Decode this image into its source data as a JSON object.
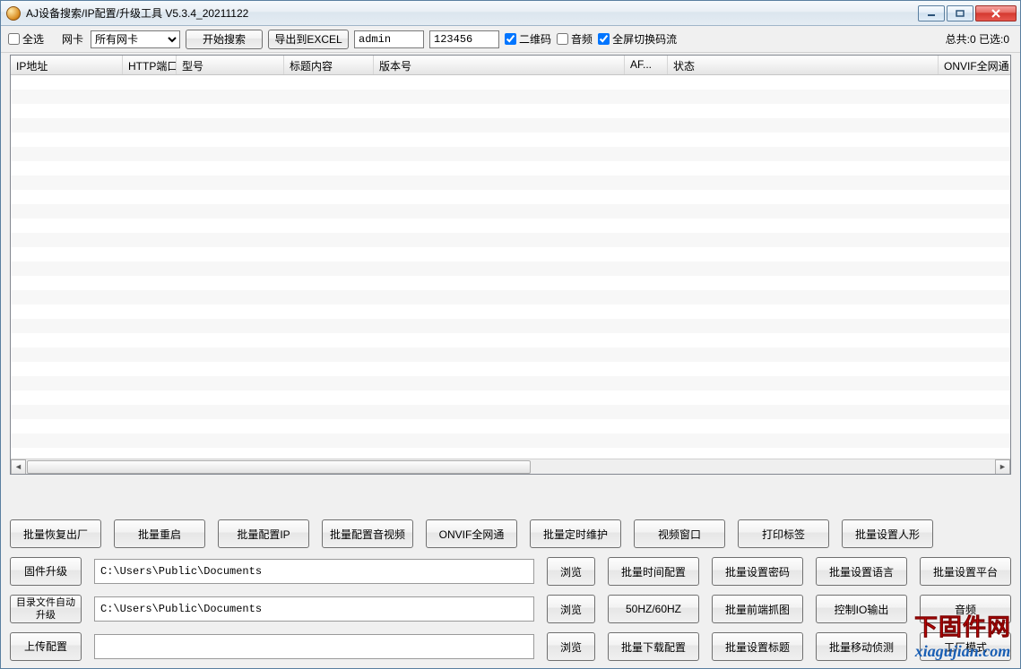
{
  "window": {
    "title": "AJ设备搜索/IP配置/升级工具 V5.3.4_20211122"
  },
  "toolbar": {
    "select_all": "全选",
    "netcard_label": "网卡",
    "netcard_value": "所有网卡",
    "start_search": "开始搜索",
    "export_excel": "导出到EXCEL",
    "username": "admin",
    "password": "123456",
    "qrcode": "二维码",
    "audio": "音频",
    "fullscreen_stream": "全屏切换码流",
    "count_info": "总共:0 已选:0"
  },
  "columns": {
    "ip": "IP地址",
    "http_port": "HTTP端口",
    "model": "型号",
    "title": "标题内容",
    "version": "版本号",
    "af": "AF...",
    "status": "状态",
    "onvif": "ONVIF全网通"
  },
  "buttons": {
    "row1": {
      "factory_reset": "批量恢复出厂",
      "reboot": "批量重启",
      "config_ip": "批量配置IP",
      "config_av": "批量配置音视频",
      "onvif_all": "ONVIF全网通",
      "time_maint": "批量定时维护",
      "video_window": "视频窗口",
      "print_label": "打印标签",
      "set_human": "批量设置人形"
    },
    "row2": {
      "firmware_upgrade": "固件升级",
      "path": "C:\\Users\\Public\\Documents",
      "browse": "浏览",
      "time_config": "批量时间配置",
      "set_password": "批量设置密码",
      "set_language": "批量设置语言",
      "set_platform": "批量设置平台"
    },
    "row3": {
      "dir_auto_upgrade": "目录文件自动\n升级",
      "path": "C:\\Users\\Public\\Documents",
      "browse": "浏览",
      "hz": "50HZ/60HZ",
      "front_capture": "批量前端抓图",
      "io_output": "控制IO输出",
      "audio_btn": "音频"
    },
    "row4": {
      "upload_config": "上传配置",
      "path": "",
      "browse": "浏览",
      "download_config": "批量下载配置",
      "set_title": "批量设置标题",
      "motion_detect": "批量移动侦测",
      "factory_mode": "工厂模式"
    }
  },
  "watermark": {
    "cn": "下固件网",
    "url": "xiagujian.com"
  }
}
